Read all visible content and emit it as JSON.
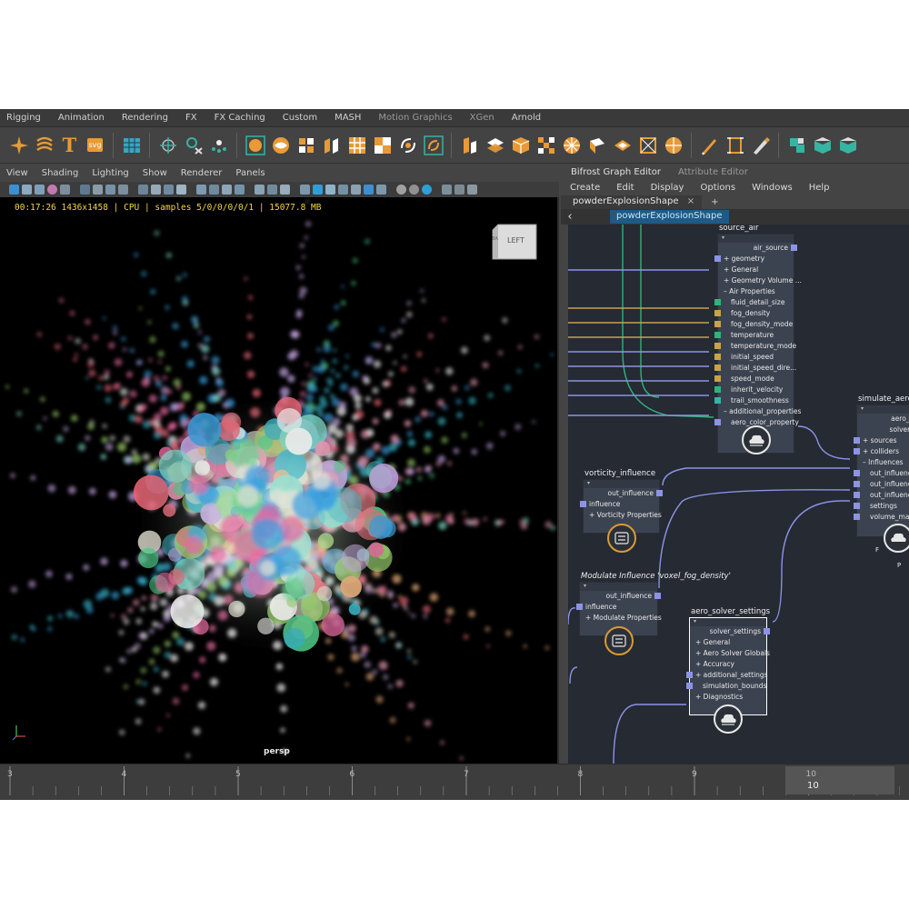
{
  "shelf_tabs": [
    "Rigging",
    "Animation",
    "Rendering",
    "FX",
    "FX Caching",
    "Custom",
    "MASH",
    "Motion Graphics",
    "XGen",
    "Arnold"
  ],
  "shelf": {
    "text_icon": "T",
    "svg_icon": "svg",
    "icon_names": [
      "sparkle-icon",
      "text-curves-icon",
      "type-tool-icon",
      "svg-tool-icon",
      "grid-icon",
      "locator-icon",
      "constraint-icon",
      "particles-icon"
    ]
  },
  "viewport": {
    "menu": [
      "View",
      "Shading",
      "Lighting",
      "Show",
      "Renderer",
      "Panels"
    ],
    "hud": "00:17:26 1436x1458 | CPU | samples 5/0/0/0/0/1 | 15077.8 MB",
    "viewcube_label": "LEFT",
    "viewcube_side": "BA",
    "camera": "persp"
  },
  "bifrost": {
    "tabs": [
      "Bifrost Graph Editor",
      "Attribute Editor"
    ],
    "menu": [
      "Create",
      "Edit",
      "Display",
      "Options",
      "Windows",
      "Help"
    ],
    "file_tab": "powderExplosionShape",
    "file_tab_close": "×",
    "add_tab": "+",
    "breadcrumb": "powderExplosionShape",
    "nodes": {
      "source_air": {
        "title": "source_air",
        "output": "air_source",
        "rows": [
          "+ geometry",
          "+ General",
          "+ Geometry Volume ...",
          "– Air Properties",
          "fluid_detail_size",
          "fog_density",
          "fog_density_mode",
          "temperature",
          "temperature_mode",
          "initial_speed",
          "initial_speed_dire...",
          "speed_mode",
          "inherit_velocity",
          "trail_smoothness",
          "– additional_properties",
          "aero_color_property"
        ]
      },
      "simulate_aero": {
        "title": "simulate_aero",
        "outputs": [
          "aero_v",
          "solver_"
        ],
        "rows": [
          "+ sources",
          "+ colliders",
          "– Influences",
          "out_influenc",
          "out_influenc",
          "out_influenc",
          "settings",
          "volume_materia"
        ],
        "foot_left": "F",
        "foot_right": "P"
      },
      "vorticity_influence": {
        "title": "vorticity_influence",
        "output": "out_influence",
        "rows": [
          "influence",
          "+ Vorticity Properties"
        ]
      },
      "modulate_influence": {
        "title": "Modulate Influence 'voxel_fog_density'",
        "output": "out_influence",
        "rows": [
          "influence",
          "+ Modulate Properties"
        ]
      },
      "aero_solver_settings": {
        "title": "aero_solver_settings",
        "output": "solver_settings",
        "rows": [
          "+ General",
          "+ Aero Solver Globals",
          "+ Accuracy",
          "+ additional_settings",
          "simulation_bounds",
          "+ Diagnostics"
        ]
      }
    }
  },
  "timeline": {
    "ticks": [
      "3",
      "4",
      "5",
      "6",
      "7",
      "8",
      "9",
      "10"
    ],
    "current_frame": "10"
  },
  "colors": {
    "hud": "#f2d34c",
    "shelf_orange": "#e89a36",
    "shelf_teal": "#36b3a3",
    "breadcrumb": "#1f5a86",
    "wire": "#8c93e6",
    "wire_teal": "#2fb37b",
    "node_bg": "#3c4350",
    "graph_bg": "#252a33",
    "foot_ring": "#d99b35"
  }
}
